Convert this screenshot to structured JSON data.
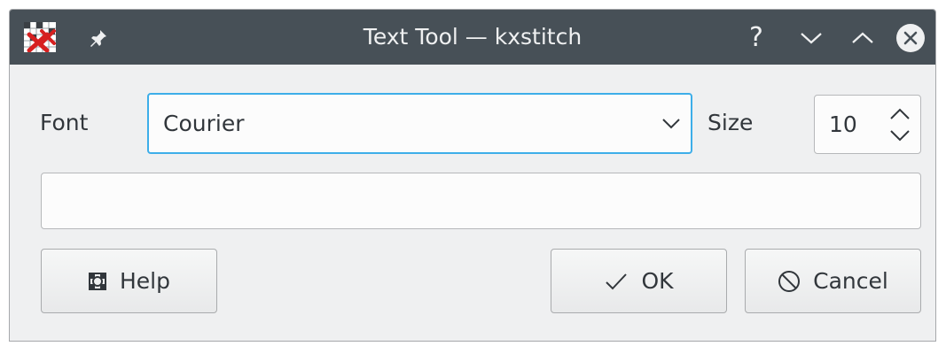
{
  "window": {
    "title": "Text Tool — kxstitch",
    "titlebar_buttons": {
      "help_glyph": "?"
    },
    "icons": {
      "app": "kxstitch-app-icon",
      "pin": "pin-icon",
      "help": "help-question-icon",
      "minimize": "chevron-down-icon",
      "maximize": "chevron-up-icon",
      "close": "close-circle-icon"
    }
  },
  "form": {
    "font_label": "Font",
    "font_value": "Courier",
    "size_label": "Size",
    "size_value": "10",
    "text_value": ""
  },
  "buttons": {
    "help_label": "Help",
    "ok_label": "OK",
    "cancel_label": "Cancel"
  },
  "colors": {
    "titlebar": "#475057",
    "focus_accent": "#3daee9",
    "window_bg": "#eff0f1",
    "text": "#31363b"
  }
}
